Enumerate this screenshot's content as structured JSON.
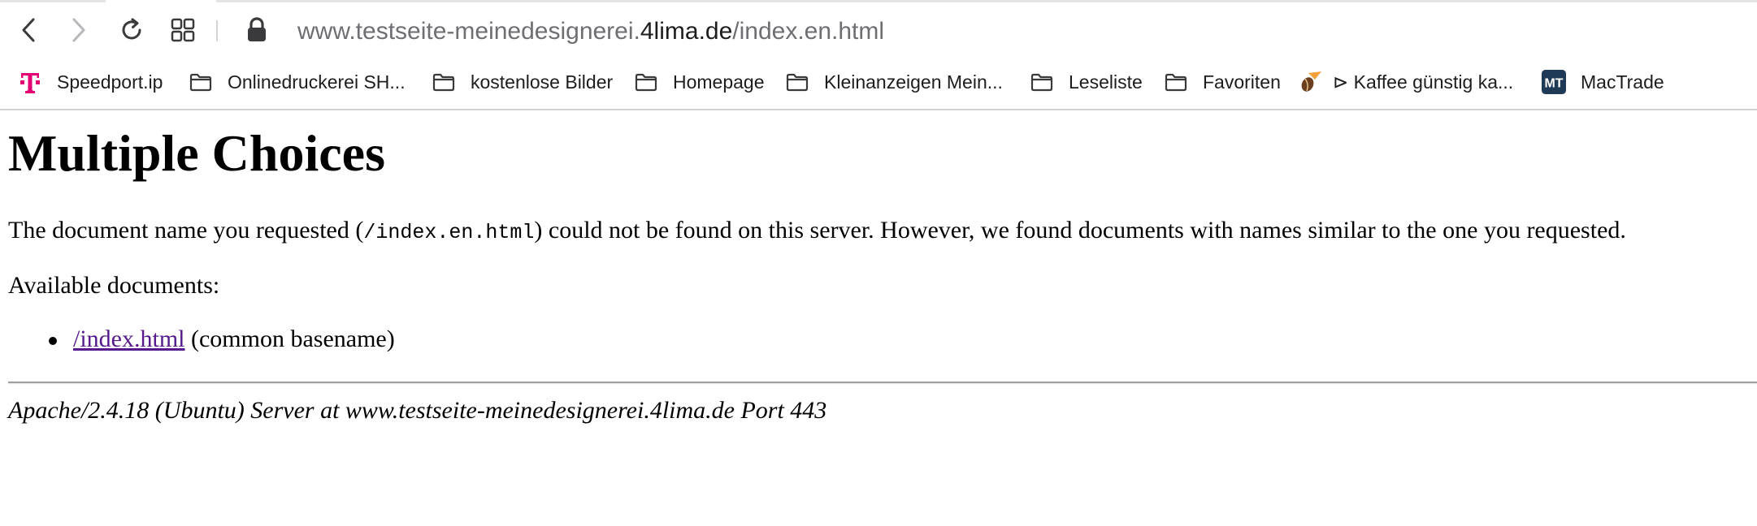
{
  "browser": {
    "url": {
      "prefix": "www.testseite-meinedesignerei.",
      "domain": "4lima.de",
      "path": "/index.en.html"
    },
    "buttons": {
      "back": "back-icon",
      "forward": "forward-icon",
      "reload": "reload-icon",
      "tabs": "tab-overview-icon",
      "lock": "lock-icon"
    },
    "bookmarks": [
      {
        "label": "Speedport.ip",
        "icon": "telekom-t-icon",
        "color": "#e20074"
      },
      {
        "label": "Onlinedruckerei SH...",
        "icon": "folder-icon"
      },
      {
        "label": "kostenlose Bilder",
        "icon": "folder-icon"
      },
      {
        "label": "Homepage",
        "icon": "folder-icon"
      },
      {
        "label": "Kleinanzeigen Mein...",
        "icon": "folder-icon"
      },
      {
        "label": "Leseliste",
        "icon": "folder-icon"
      },
      {
        "label": "Favoriten",
        "icon": "folder-icon"
      },
      {
        "label": "⊳ Kaffee günstig ka...",
        "icon": "coffee-bean-icon"
      },
      {
        "label": "MacTrade",
        "icon": "mactrade-logo-icon",
        "logo_text": "MT",
        "color": "#1f3a56"
      }
    ]
  },
  "page": {
    "heading": "Multiple Choices",
    "message_before": "The document name you requested (",
    "requested_path": "/index.en.html",
    "message_after": ") could not be found on this server. However, we found documents with names similar to the one you requested.",
    "available_label": "Available documents:",
    "documents": [
      {
        "link": "/index.html",
        "note": " (common basename)"
      }
    ],
    "footer": "Apache/2.4.18 (Ubuntu) Server at www.testseite-meinedesignerei.4lima.de Port 443"
  },
  "colors": {
    "link_visited": "#551a8b",
    "url_grey": "#6e6e73",
    "url_dark": "#1d1d1f"
  }
}
